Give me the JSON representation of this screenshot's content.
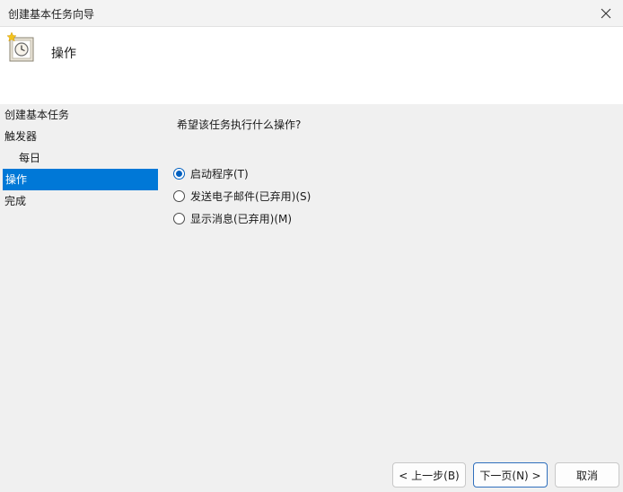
{
  "window": {
    "title": "创建基本任务向导"
  },
  "header": {
    "title": "操作"
  },
  "sidebar": {
    "items": [
      {
        "label": "创建基本任务"
      },
      {
        "label": "触发器"
      },
      {
        "label": "每日"
      },
      {
        "label": "操作"
      },
      {
        "label": "完成"
      }
    ],
    "selected": "操作"
  },
  "main": {
    "question": "希望该任务执行什么操作?",
    "options": [
      {
        "label": "启动程序(T)",
        "checked": true
      },
      {
        "label": "发送电子邮件(已弃用)(S)",
        "checked": false
      },
      {
        "label": "显示消息(已弃用)(M)",
        "checked": false
      }
    ]
  },
  "buttons": {
    "back": "< 上一步(B)",
    "next": "下一页(N) >",
    "cancel": "取消"
  },
  "colors": {
    "accent": "#0078d7"
  }
}
